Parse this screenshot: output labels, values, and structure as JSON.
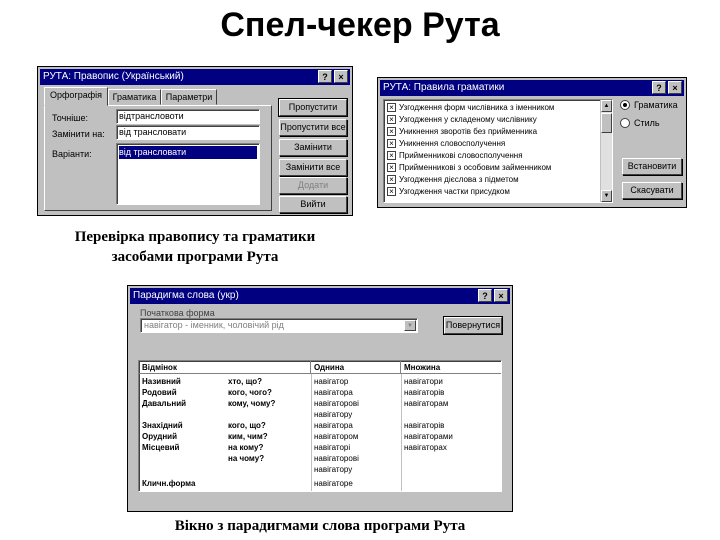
{
  "page": {
    "title": "Спел-чекер Рута",
    "caption1_line1": "Перевірка правопису  та граматики",
    "caption1_line2": "засобами програми Рута",
    "caption2": "Вікно з парадигмами слова  програми Рута"
  },
  "spell_dialog": {
    "title": "РУТА: Правопис (Український)",
    "help": "?",
    "close": "×",
    "tabs": [
      "Орфографія",
      "Граматика",
      "Параметри"
    ],
    "labels": {
      "not_in_dict": "Точніше:",
      "change_to": "Замінити на:",
      "variants": "Варіанти:"
    },
    "not_in_dict_value": "відтрансловоти",
    "change_to_value": "від трансловати",
    "suggestions": [
      "від трансловати"
    ],
    "buttons": {
      "skip": "Пропустити",
      "skip_all": "Пропустити все",
      "replace": "Замінити",
      "replace_all": "Замінити все",
      "add": "Додати",
      "exit": "Вийти"
    }
  },
  "grammar_dialog": {
    "title": "РУТА: Правила граматики",
    "help": "?",
    "close": "×",
    "rules": [
      "Узгодження форм числівника з іменником",
      "Узгодження у складеному числівнику",
      "Уникнення зворотів без прийменника",
      "Уникнення словосполучення",
      "Прийменникові словосполучення",
      "Прийменникові з особовим займенником",
      "Узгодження дієслова з підметом",
      "Узгодження частки присудком"
    ],
    "radio_labels": [
      "Граматика",
      "Стиль"
    ],
    "buttons": {
      "all": "Встановити",
      "reset": "Скасувати"
    }
  },
  "paradigm_dialog": {
    "title": "Парадигма слова (укр)",
    "help": "?",
    "close": "×",
    "initial_form_label": "Початкова форма",
    "initial_form_value": "навігатор - іменник, чоловічий рід",
    "back_button": "Повернутися",
    "columns": [
      "Відмінок",
      "",
      "Однина",
      "Множина"
    ],
    "rows": [
      {
        "case": "Називний",
        "question": "хто, що?",
        "singular": "навігатор",
        "plural": "навігатори"
      },
      {
        "case": "Родовий",
        "question": "кого, чого?",
        "singular": "навігатора",
        "plural": "навігаторів"
      },
      {
        "case": "Давальний",
        "question": "кому, чому?",
        "singular": "навігаторові",
        "plural": "навігаторам"
      },
      {
        "case": "",
        "question": "",
        "singular": "навігатору",
        "plural": ""
      },
      {
        "case": "Знахідний",
        "question": "кого, що?",
        "singular": "навігатора",
        "plural": "навігаторів"
      },
      {
        "case": "Орудний",
        "question": "ким, чим?",
        "singular": "навігатором",
        "plural": "навігаторами"
      },
      {
        "case": "Місцевий",
        "question": "на кому?",
        "singular": "навігаторі",
        "plural": "навігаторах"
      },
      {
        "case": "",
        "question": "на чому?",
        "singular": "навігаторові",
        "plural": ""
      },
      {
        "case": "",
        "question": "",
        "singular": "навігатору",
        "plural": ""
      },
      {
        "case": "Кличн.форма",
        "question": "",
        "singular": "навігаторе",
        "plural": ""
      }
    ]
  }
}
